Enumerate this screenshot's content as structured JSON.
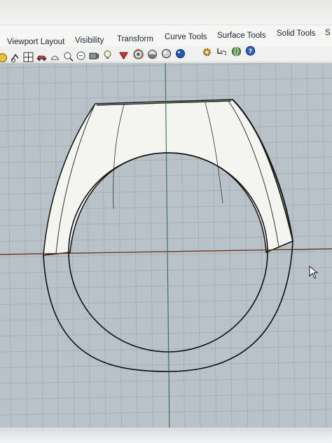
{
  "ribbon": {
    "tabs": [
      {
        "label": "Viewport Layout"
      },
      {
        "label": "Visibility"
      },
      {
        "label": "Transform"
      },
      {
        "label": "Curve Tools"
      },
      {
        "label": "Surface Tools"
      },
      {
        "label": "Solid Tools"
      },
      {
        "label": "S"
      }
    ]
  },
  "toolbar": {
    "icons": [
      "pan-icon",
      "rotate-view-icon",
      "four-viewports-icon",
      "car-icon",
      "wireframe-icon",
      "zoom-extents-icon",
      "named-view-icon",
      "camera-icon",
      "light-bulb-icon",
      "render-material-icon",
      "color-wheel-icon",
      "sphere-shaded-icon",
      "sphere-rendered-icon",
      "sphere-blue-icon",
      "settings-gear-icon",
      "snap-grid-icon",
      "globe-icon",
      "help-icon"
    ]
  },
  "viewport": {
    "view": "Front",
    "grid": true,
    "colors": {
      "background": "#b9c2c8",
      "grid": "#9ea8ae",
      "x_axis": "#a0522d",
      "y_axis": "#2e8b57",
      "surface": "#f4f4f0",
      "curve": "#1a1a1a"
    }
  }
}
